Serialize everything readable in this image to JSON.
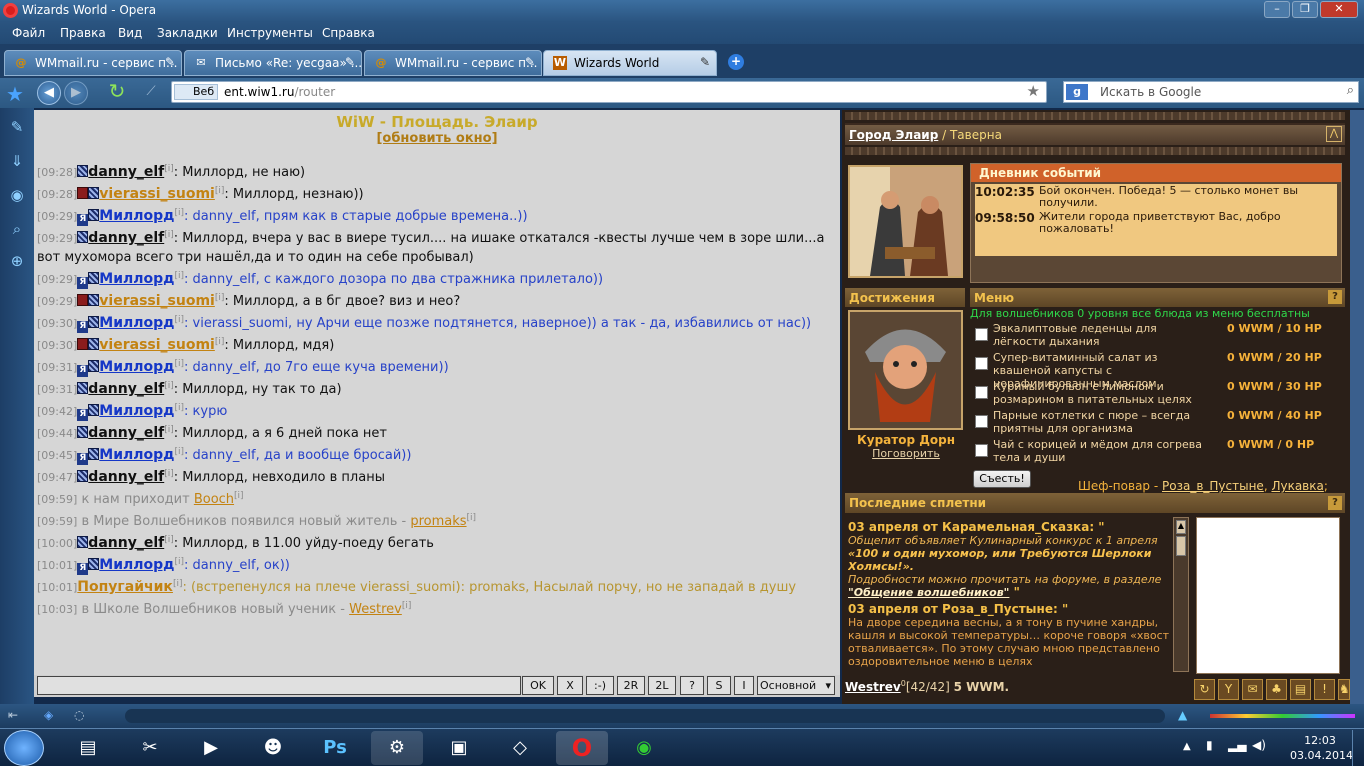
{
  "window": {
    "title": "Wizards World - Opera",
    "minimize": "–",
    "maximize": "❐",
    "close": "✕"
  },
  "menu": [
    "Файл",
    "Правка",
    "Вид",
    "Закладки",
    "Инструменты",
    "Справка"
  ],
  "tabs": [
    {
      "label": "WMmail.ru - сервис п...",
      "icon": "@"
    },
    {
      "label": "Письмо «Re: yecgaa» ...",
      "icon": "✉"
    },
    {
      "label": "WMmail.ru - сервис п...",
      "icon": "@"
    },
    {
      "label": "Wizards World",
      "icon": "W",
      "active": true
    }
  ],
  "tab_close": "✎",
  "tab_add": "+",
  "address": {
    "prefix": "Веб",
    "host": "ent.wiw1.ru",
    "path": "/router",
    "star": "★"
  },
  "search": {
    "engine": "g",
    "placeholder": "Искать в Google",
    "go": "⌕"
  },
  "chat": {
    "title": "WiW - Площадь. Элаир",
    "refresh": "[обновить окно]",
    "messages": [
      {
        "time": "09:28",
        "badges": [
          "b3"
        ],
        "nick": "danny_elf",
        "nc": "dk",
        "text": ": Миллорд, не наю)",
        "tc": ""
      },
      {
        "time": "09:28",
        "badges": [
          "b1",
          "b3"
        ],
        "nick": "vierassi_suomi",
        "nc": "or",
        "text": ": Миллорд, незнаю))",
        "tc": ""
      },
      {
        "time": "09:29",
        "badges": [
          "b2",
          "b3"
        ],
        "nick": "Миллорд",
        "nc": "bl",
        "text": ": danny_elf, прям как в старые добрые времена..))",
        "tc": "blue"
      },
      {
        "time": "09:29",
        "badges": [
          "b3"
        ],
        "nick": "danny_elf",
        "nc": "dk",
        "text": ": Миллорд, вчера у вас в виере тусил.... на ишаке откатался -квесты лучше чем в зоре шли...а вот мухомора всего три нашёл,да и то один на себе пробывал)",
        "tc": ""
      },
      {
        "time": "09:29",
        "badges": [
          "b2",
          "b3"
        ],
        "nick": "Миллорд",
        "nc": "bl",
        "text": ": danny_elf, с каждого дозора по два стражника прилетало))",
        "tc": "blue"
      },
      {
        "time": "09:29",
        "badges": [
          "b1",
          "b3"
        ],
        "nick": "vierassi_suomi",
        "nc": "or",
        "text": ": Миллорд, а в бг двое? виз и нео?",
        "tc": ""
      },
      {
        "time": "09:30",
        "badges": [
          "b2",
          "b3"
        ],
        "nick": "Миллорд",
        "nc": "bl",
        "text": ": vierassi_suomi, ну Арчи еще позже подтянется, наверное)) а так - да, избавились от нас))",
        "tc": "blue"
      },
      {
        "time": "09:30",
        "badges": [
          "b1",
          "b3"
        ],
        "nick": "vierassi_suomi",
        "nc": "or",
        "text": ": Миллорд, мдя)",
        "tc": ""
      },
      {
        "time": "09:31",
        "badges": [
          "b2",
          "b3"
        ],
        "nick": "Миллорд",
        "nc": "bl",
        "text": ": danny_elf, до 7го еще куча времени))",
        "tc": "blue"
      },
      {
        "time": "09:31",
        "badges": [
          "b3"
        ],
        "nick": "danny_elf",
        "nc": "dk",
        "text": ": Миллорд, ну так то да)",
        "tc": ""
      },
      {
        "time": "09:42",
        "badges": [
          "b2",
          "b3"
        ],
        "nick": "Миллорд",
        "nc": "bl",
        "text": ": курю",
        "tc": "blue"
      },
      {
        "time": "09:44",
        "badges": [
          "b3"
        ],
        "nick": "danny_elf",
        "nc": "dk",
        "text": ": Миллорд, а я 6 дней пока нет",
        "tc": ""
      },
      {
        "time": "09:45",
        "badges": [
          "b2",
          "b3"
        ],
        "nick": "Миллорд",
        "nc": "bl",
        "text": ": danny_elf, да и вообще бросай))",
        "tc": "blue"
      },
      {
        "time": "09:47",
        "badges": [
          "b3"
        ],
        "nick": "danny_elf",
        "nc": "dk",
        "text": ": Миллорд, невходило в планы",
        "tc": ""
      }
    ],
    "sys1": {
      "time": "09:59",
      "text": "к нам приходит ",
      "link": "Booch"
    },
    "sys2": {
      "time": "09:59",
      "text": "в Мире Волшебников появился новый житель - ",
      "link": "promaks"
    },
    "messages2": [
      {
        "time": "10:00",
        "badges": [
          "b3"
        ],
        "nick": "danny_elf",
        "nc": "dk",
        "text": ": Миллорд, в 11.00 уйду-поеду бегать",
        "tc": ""
      },
      {
        "time": "10:01",
        "badges": [
          "b2",
          "b3"
        ],
        "nick": "Миллорд",
        "nc": "bl",
        "text": ": danny_elf, ок))",
        "tc": "blue"
      }
    ],
    "parrot": {
      "time": "10:01",
      "nick": "Попугайчик",
      "text": ": (встрепенулся на плече vierassi_suomi): promaks, Насылай порчу, но не западай в душу"
    },
    "sys3": {
      "time": "10:03",
      "text": "в Школе Волшебников новый ученик - ",
      "link": "Westrev"
    },
    "info": "[i]",
    "badge_letter": "Я",
    "buttons": [
      "OK",
      "X",
      ":-)",
      "2R",
      "2L",
      "?",
      "S",
      "I"
    ],
    "channel": "Основной"
  },
  "game": {
    "location": {
      "city": "Город Элаир",
      "sep": " / ",
      "place": "Таверна"
    },
    "diary": {
      "title": "Дневник событий",
      "events": [
        {
          "time": "10:02:35",
          "text": "Бой окончен. Победа! 5 — столько монет вы получили."
        },
        {
          "time": "09:58:50",
          "text": "Жители города приветствуют Вас, добро пожаловать!"
        }
      ]
    },
    "achievements": "Достижения",
    "menu_title": "Меню",
    "help": "?",
    "menu_note": "Для волшебников 0 уровня все блюда из меню бесплатны",
    "dishes": [
      {
        "name": "Эвкалиптовые леденцы для лёгкости дыхания",
        "price": "0 WWM / 10 HP"
      },
      {
        "name": "Супер-витаминный салат из квашеной капусты с нерафинированным маслом",
        "price": "0 WWM / 20 HP"
      },
      {
        "name": "Куриный бульон с лимоном и розмарином в питательных целях",
        "price": "0 WWM / 30 HP"
      },
      {
        "name": "Парные котлетки с пюре – всегда приятны для организма",
        "price": "0 WWM / 40 HP"
      },
      {
        "name": "Чай с корицей и мёдом для согрева тела и души",
        "price": "0 WWM / 0 HP"
      }
    ],
    "eat_button": "Съесть!",
    "chef": {
      "label": "Шеф-повар - ",
      "name1": "Роза_в_Пустыне",
      "name2": "Лукавка",
      "sep": ", ",
      "end": ";"
    },
    "curator": "Куратор Дорн",
    "talk": "Поговорить",
    "gossip_title": "Последние сплетни",
    "gossip": {
      "h1": "03 апреля от Карамельная_Сказка:  \"",
      "i1": "Общепит объявляет Кулинарный конкурс к 1 апреля",
      "b1": "«100 и один мухомор, или Требуются Шерлоки Холмсы!».",
      "i2": "Подробности можно прочитать на форуме, в разделе",
      "u1": "\"Общение волшебников\"",
      "q1": " \"",
      "h2": "03 апреля от Роза_в_Пустыне:  \"",
      "p2": "На дворе середина весны, а я тону в пучине хандры, кашля и высокой температуры… короче говоря «хвост отваливается». По этому случаю мною представлено оздоровительное меню в целях"
    },
    "status": {
      "name": "Westrev",
      "level": "0",
      "hp": "[42/42]",
      "money": "5 WWM."
    },
    "tools": [
      "↻",
      "Y",
      "✉",
      "♣",
      "▤",
      "!",
      "♞"
    ]
  },
  "taskbar": {
    "time": "12:03",
    "date": "03.04.2014"
  },
  "colors": {
    "chat_bg": "#d6d6d6",
    "game_bg": "#2a1f18",
    "accent": "#f3c24d"
  }
}
